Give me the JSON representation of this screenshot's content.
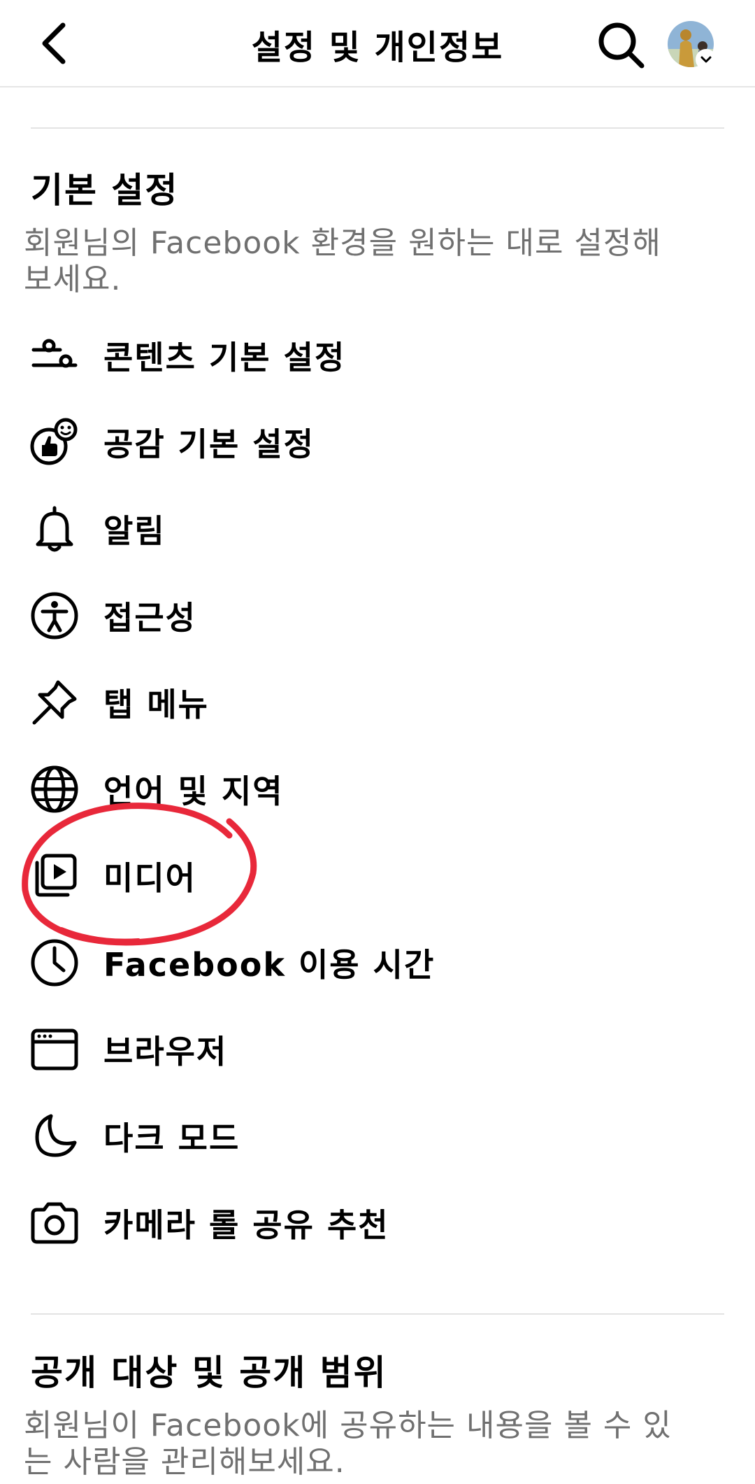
{
  "header": {
    "title": "설정 및 개인정보",
    "back_icon": "chevron-left-icon",
    "search_icon": "search-icon"
  },
  "preferences": {
    "title": "기본 설정",
    "description": "회원님의 Facebook 환경을 원하는 대로 설정해보세요.",
    "items": [
      {
        "label": "콘텐츠 기본 설정",
        "icon": "sliders-icon"
      },
      {
        "label": "공감 기본 설정",
        "icon": "reaction-icon"
      },
      {
        "label": "알림",
        "icon": "bell-icon"
      },
      {
        "label": "접근성",
        "icon": "accessibility-icon"
      },
      {
        "label": "탭 메뉴",
        "icon": "pin-icon"
      },
      {
        "label": "언어 및 지역",
        "icon": "globe-icon"
      },
      {
        "label": "미디어",
        "icon": "media-icon"
      },
      {
        "label": "Facebook 이용 시간",
        "icon": "clock-icon"
      },
      {
        "label": "브라우저",
        "icon": "browser-icon"
      },
      {
        "label": "다크 모드",
        "icon": "moon-icon"
      },
      {
        "label": "카메라 롤 공유 추천",
        "icon": "camera-icon"
      }
    ]
  },
  "audience": {
    "title": "공개 대상 및 공개 범위",
    "description": "회원님이 Facebook에 공유하는 내용을 볼 수 있는 사람을 관리해보세요."
  },
  "colors": {
    "highlight": "#e8283a",
    "divider": "#e3e3e3",
    "secondary_text": "#707070"
  }
}
